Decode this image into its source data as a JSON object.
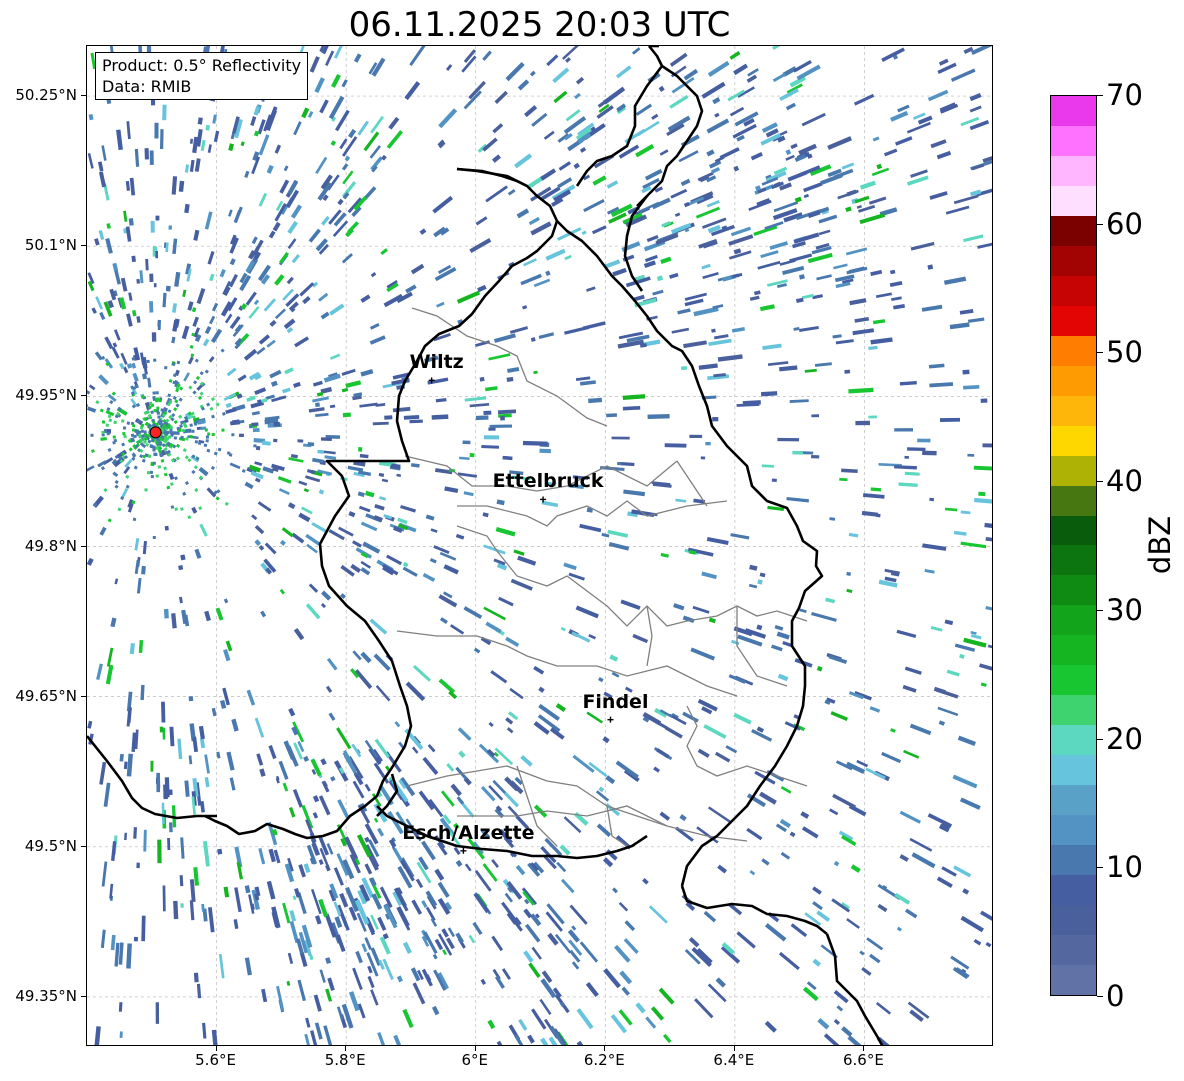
{
  "title": "06.11.2025 20:03 UTC",
  "product_box": {
    "product": "Product: 0.5° Reflectivity",
    "data": "Data: RMIB"
  },
  "map": {
    "lon_range": [
      5.4,
      6.8
    ],
    "lat_range": [
      49.3,
      50.3
    ],
    "lat_ticks": [
      "50.25°N",
      "50.1°N",
      "49.95°N",
      "49.8°N",
      "49.65°N",
      "49.5°N",
      "49.35°N"
    ],
    "lat_tick_values": [
      50.25,
      50.1,
      49.95,
      49.8,
      49.65,
      49.5,
      49.35
    ],
    "lon_ticks": [
      "5.6°E",
      "5.8°E",
      "6°E",
      "6.2°E",
      "6.4°E",
      "6.6°E"
    ],
    "lon_tick_values": [
      5.6,
      5.8,
      6.0,
      6.2,
      6.4,
      6.6
    ],
    "radar_site": {
      "lon": 5.506,
      "lat": 49.914,
      "color": "#ff2222"
    },
    "cities": [
      {
        "name": "Wiltz",
        "lon": 5.932,
        "lat": 49.966
      },
      {
        "name": "Ettelbruck",
        "lon": 6.104,
        "lat": 49.847
      },
      {
        "name": "Findel",
        "lon": 6.208,
        "lat": 49.627
      },
      {
        "name": "Esch/Alzette",
        "lon": 5.981,
        "lat": 49.496
      }
    ],
    "border_color": "#000000",
    "district_color": "#808080",
    "grid": true
  },
  "colorbar": {
    "label": "dBZ",
    "min": 0,
    "max": 70,
    "tick_labels": [
      "0",
      "10",
      "20",
      "30",
      "40",
      "50",
      "60",
      "70"
    ],
    "colors": [
      "#6172a7",
      "#54689f",
      "#4a609c",
      "#455ea2",
      "#4878ad",
      "#5293c4",
      "#59a1c6",
      "#67c4dd",
      "#5cd8c0",
      "#3fd370",
      "#18c631",
      "#14b520",
      "#12a41a",
      "#0f8a13",
      "#0d7510",
      "#0a5c0d",
      "#467710",
      "#adb205",
      "#ffd700",
      "#ffb60b",
      "#ff9b02",
      "#ff7d00",
      "#e30404",
      "#c60404",
      "#a20303",
      "#7b0000",
      "#ffdfff",
      "#ffb6ff",
      "#ff71ff",
      "#ea39ed"
    ]
  }
}
